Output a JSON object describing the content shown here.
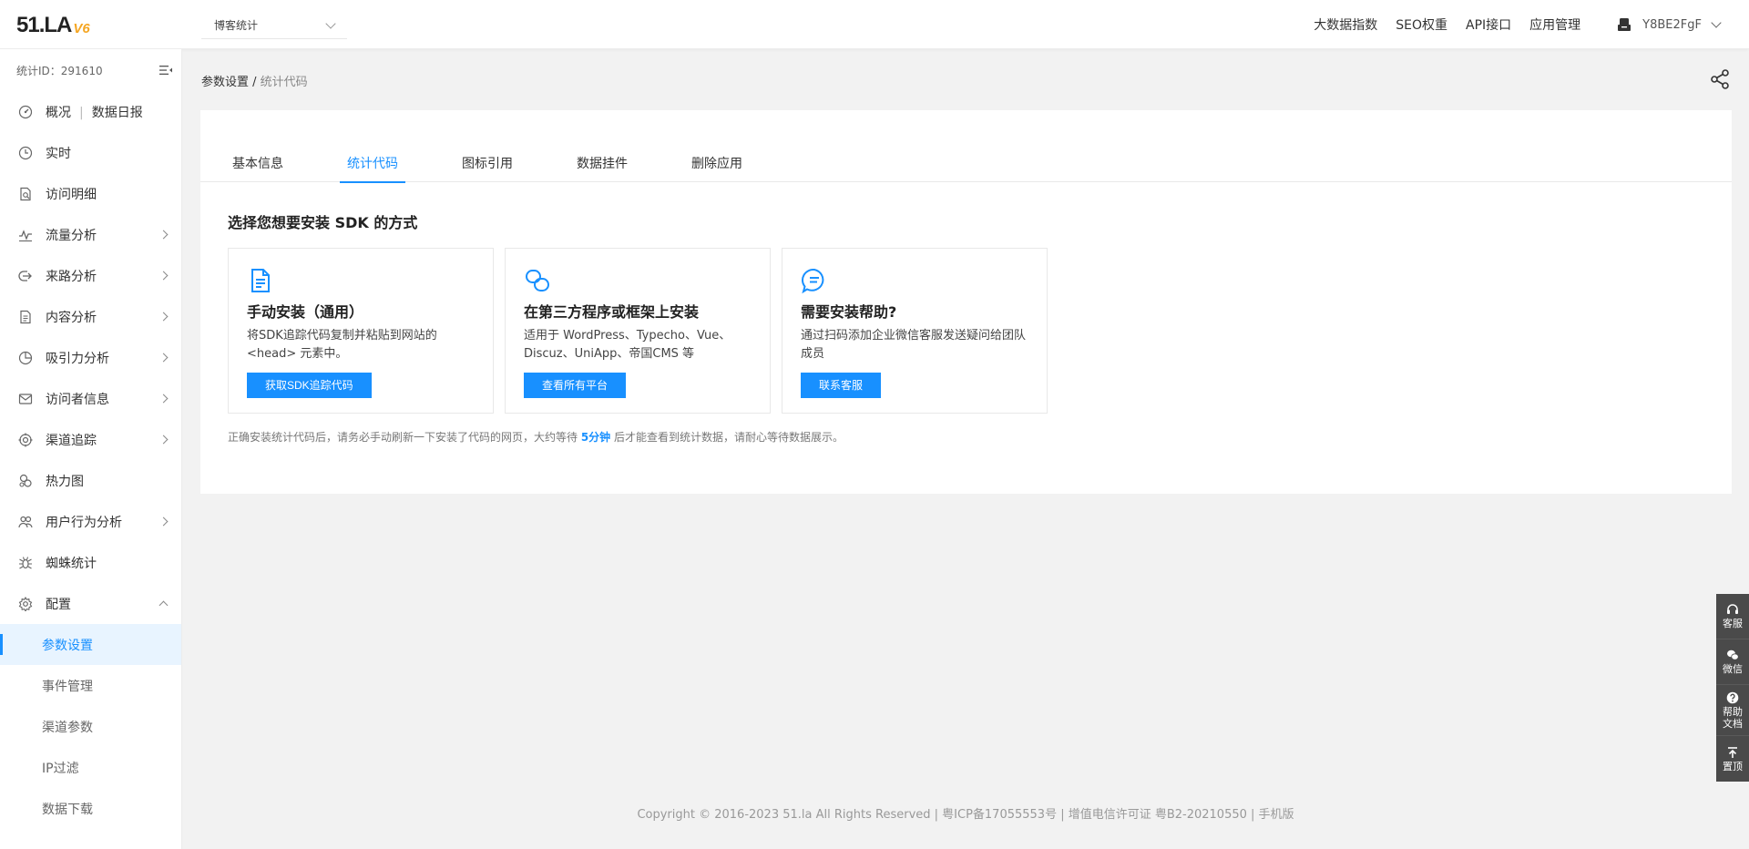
{
  "header": {
    "logo_main": "51.LA",
    "logo_version": "V6",
    "site_select": "博客统计",
    "nav": [
      "大数据指数",
      "SEO权重",
      "API接口",
      "应用管理"
    ],
    "username": "Y8BE2FgF"
  },
  "sidebar": {
    "stat_id": "统计ID：291610",
    "items": [
      {
        "label": "概况",
        "label2": "数据日报",
        "icon": "dashboard-icon"
      },
      {
        "label": "实时",
        "icon": "clock-icon"
      },
      {
        "label": "访问明细",
        "icon": "detail-icon"
      },
      {
        "label": "流量分析",
        "icon": "pulse-icon"
      },
      {
        "label": "来路分析",
        "icon": "source-icon"
      },
      {
        "label": "内容分析",
        "icon": "document-icon"
      },
      {
        "label": "吸引力分析",
        "icon": "pie-icon"
      },
      {
        "label": "访问者信息",
        "icon": "mail-icon"
      },
      {
        "label": "渠道追踪",
        "icon": "target-icon"
      },
      {
        "label": "热力图",
        "icon": "heatmap-icon"
      },
      {
        "label": "用户行为分析",
        "icon": "users-icon"
      },
      {
        "label": "蜘蛛统计",
        "icon": "spider-icon"
      },
      {
        "label": "配置",
        "icon": "gear-icon"
      }
    ],
    "sub_items": [
      "参数设置",
      "事件管理",
      "渠道参数",
      "IP过滤",
      "数据下载"
    ]
  },
  "breadcrumb": {
    "parent": "参数设置",
    "separator": " / ",
    "current": "统计代码"
  },
  "tabs": [
    "基本信息",
    "统计代码",
    "图标引用",
    "数据挂件",
    "删除应用"
  ],
  "section_title": "选择您想要安装 SDK 的方式",
  "cards": [
    {
      "title": "手动安装（通用）",
      "desc": "将SDK追踪代码复制并粘贴到网站的 <head> 元素中。",
      "button": "获取SDK追踪代码"
    },
    {
      "title": "在第三方程序或框架上安装",
      "desc": "适用于 WordPress、Typecho、Vue、Discuz、UniApp、帝国CMS 等",
      "button": "查看所有平台"
    },
    {
      "title": "需要安装帮助?",
      "desc": "通过扫码添加企业微信客服发送疑问给团队成员",
      "button": "联系客服"
    }
  ],
  "note": {
    "before": "正确安装统计代码后，请务必手动刷新一下安装了代码的网页，大约等待 ",
    "highlight": "5分钟",
    "after": " 后才能查看到统计数据，请耐心等待数据展示。"
  },
  "footer": "Copyright © 2016-2023 51.la All Rights Reserved | 粤ICP备17055553号 | 增值电信许可证 粤B2-20210550 | 手机版",
  "floatbar": [
    "客服",
    "微信",
    "帮助文档",
    "置顶"
  ],
  "colors": {
    "accent": "#1890ff",
    "floatbar": "#4a4a4a",
    "logo_version": "#f5a623"
  }
}
